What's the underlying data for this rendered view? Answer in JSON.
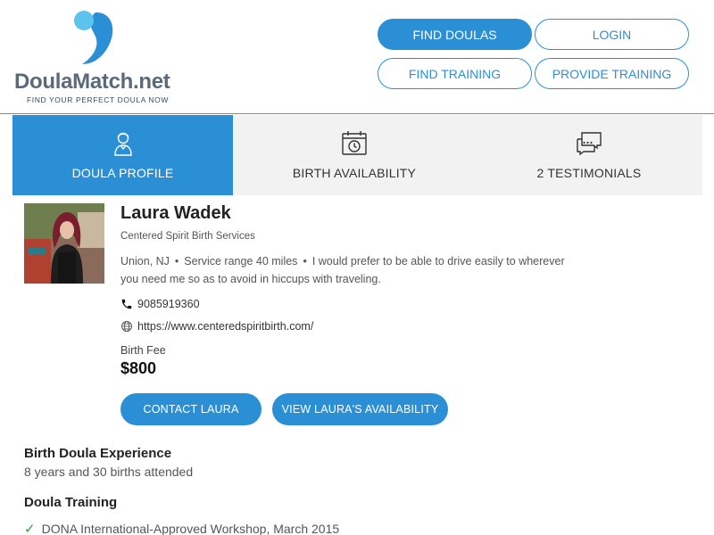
{
  "brand": {
    "name": "DoulaMatch.net",
    "tagline": "FIND YOUR PERFECT DOULA NOW",
    "colors": {
      "accent": "#2b8fd6",
      "logo_light": "#5cc3ee",
      "logo_dark": "#2b8fd6",
      "text_gray": "#5a6a7a"
    }
  },
  "nav": {
    "find_doulas": "FIND DOULAS",
    "login": "LOGIN",
    "find_training": "FIND TRAINING",
    "provide_training": "PROVIDE TRAINING"
  },
  "tabs": [
    {
      "label": "DOULA PROFILE",
      "icon": "doula-person-icon",
      "active": true
    },
    {
      "label": "BIRTH AVAILABILITY",
      "icon": "calendar-clock-icon",
      "active": false
    },
    {
      "label": "2 TESTIMONIALS",
      "icon": "chat-bubbles-icon",
      "active": false
    }
  ],
  "profile": {
    "name": "Laura Wadek",
    "company": "Centered Spirit Birth Services",
    "location": "Union, NJ",
    "service_range": "Service range 40 miles",
    "travel_note": "I would prefer to be able to drive easily to wherever you need me so as to avoid in hiccups with traveling.",
    "phone": "9085919360",
    "website": "https://www.centeredspiritbirth.com/",
    "fee_label": "Birth Fee",
    "fee_value": "$800",
    "contact_button": "CONTACT LAURA",
    "availability_button": "VIEW LAURA'S AVAILABILITY"
  },
  "experience": {
    "title": "Birth Doula Experience",
    "text": "8 years and 30 births attended"
  },
  "training": {
    "title": "Doula Training",
    "items": [
      "DONA International-Approved Workshop, March 2015"
    ]
  }
}
